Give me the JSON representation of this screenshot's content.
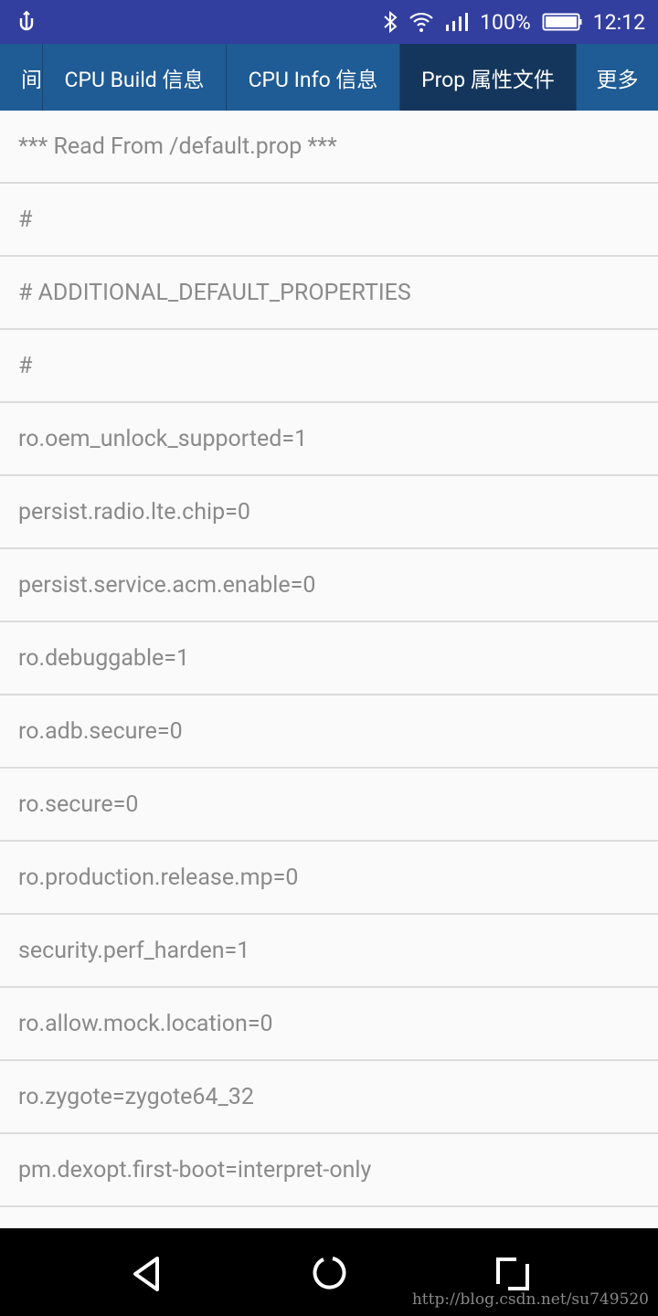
{
  "status_bar": {
    "time": "12:12",
    "battery": "100%",
    "icons": [
      "usb-icon",
      "bluetooth-icon",
      "wifi-icon",
      "signal-icon",
      "battery-icon"
    ]
  },
  "tabs": [
    {
      "label": "间"
    },
    {
      "label": "CPU Build 信息"
    },
    {
      "label": "CPU Info 信息"
    },
    {
      "label": "Prop 属性文件",
      "selected": true
    },
    {
      "label": "更多"
    }
  ],
  "rows": [
    "*** Read From /default.prop ***",
    "#",
    "# ADDITIONAL_DEFAULT_PROPERTIES",
    "#",
    "ro.oem_unlock_supported=1",
    "persist.radio.lte.chip=0",
    "persist.service.acm.enable=0",
    "ro.debuggable=1",
    "ro.adb.secure=0",
    "ro.secure=0",
    "ro.production.release.mp=0",
    "security.perf_harden=1",
    "ro.allow.mock.location=0",
    "ro.zygote=zygote64_32",
    "pm.dexopt.first-boot=interpret-only",
    ""
  ],
  "watermark": "http://blog.csdn.net/su749520",
  "colors": {
    "status_bar": "#323f9f",
    "tab_bar": "#1f5b94",
    "tab_selected": "#14365c"
  }
}
